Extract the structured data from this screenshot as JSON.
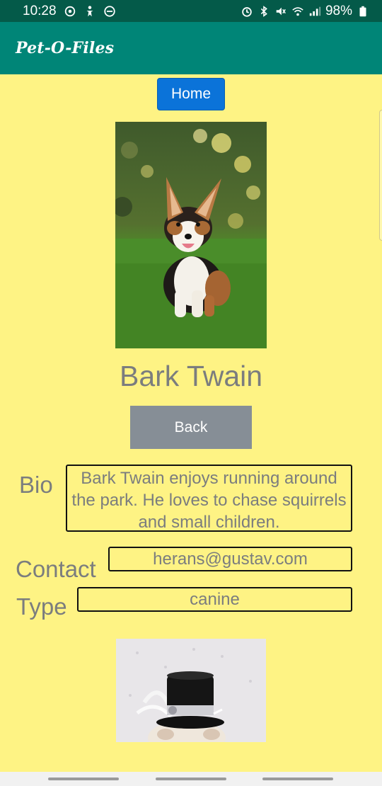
{
  "status_bar": {
    "time": "10:28",
    "battery": "98%"
  },
  "app_bar": {
    "title": "Pet-O-Files"
  },
  "home_button": "Home",
  "pet": {
    "name": "Bark Twain",
    "back_label": "Back",
    "bio_label": "Bio",
    "bio": "Bark Twain enjoys running around the park. He loves to chase squirrels and small children.",
    "contact_label": "Contact",
    "contact": "herans@gustav.com",
    "type_label": "Type",
    "type": "canine"
  },
  "colors": {
    "status_bar": "#045a49",
    "app_bar": "#008577",
    "background": "#fef384",
    "home_button": "#0b73d9",
    "back_button": "#868e96",
    "text_gray": "#7b7d7e"
  }
}
